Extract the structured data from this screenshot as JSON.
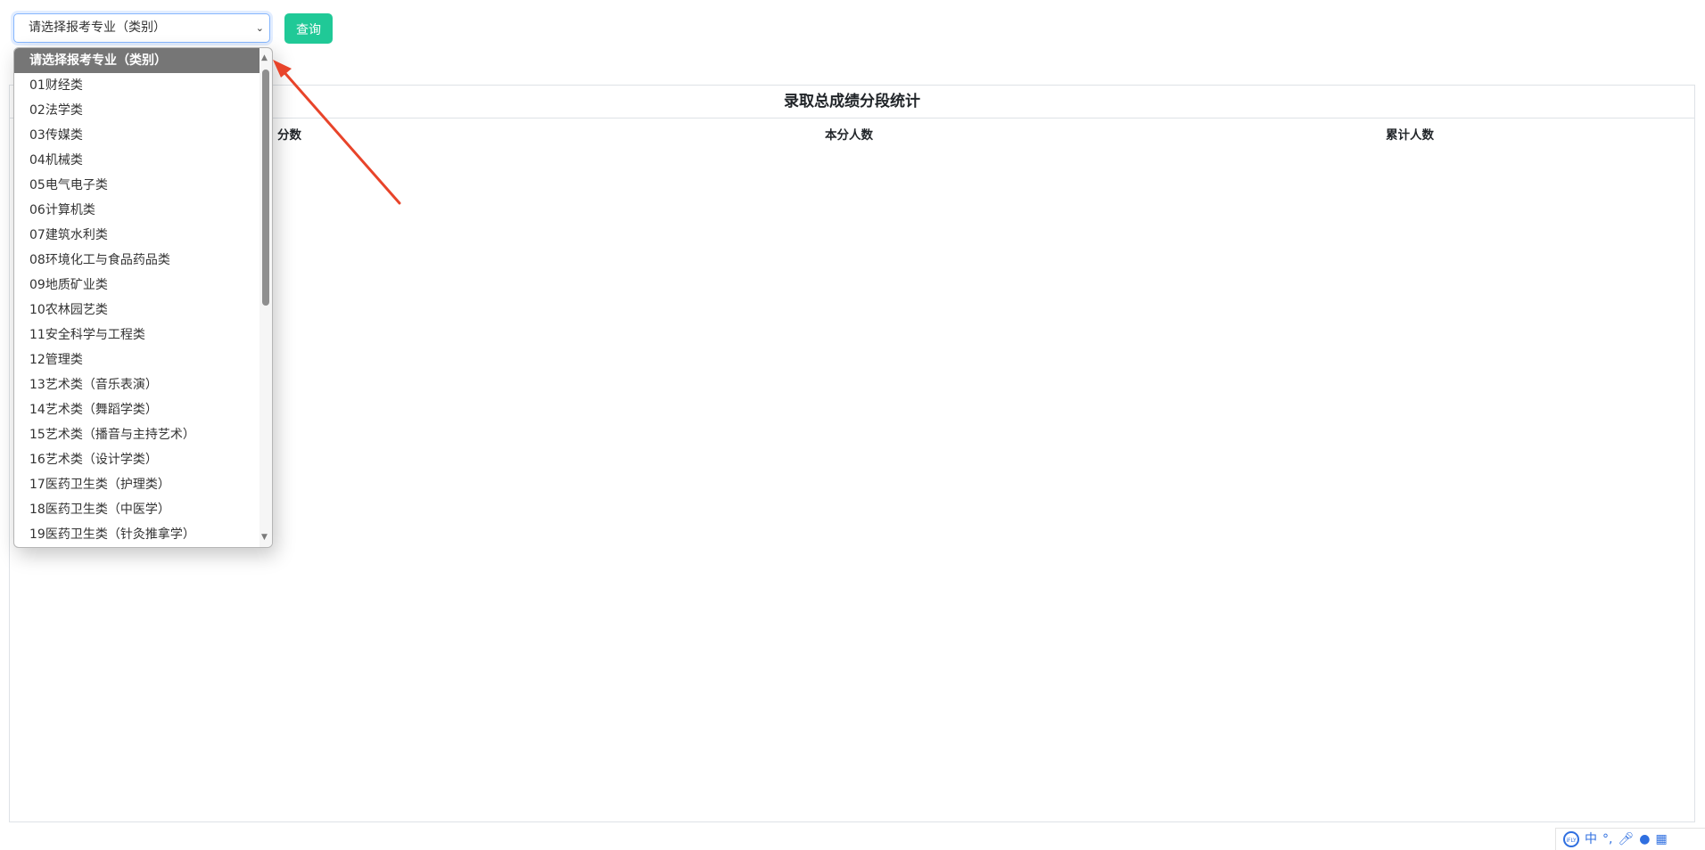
{
  "select": {
    "placeholder": "请选择报考专业（类别）"
  },
  "query_button": {
    "label": "查询"
  },
  "panel": {
    "title": "录取总成绩分段统计",
    "columns": [
      "分数",
      "本分人数",
      "累计人数"
    ]
  },
  "dropdown": {
    "options": [
      "请选择报考专业（类别）",
      "01财经类",
      "02法学类",
      "03传媒类",
      "04机械类",
      "05电气电子类",
      "06计算机类",
      "07建筑水利类",
      "08环境化工与食品药品类",
      "09地质矿业类",
      "10农林园艺类",
      "11安全科学与工程类",
      "12管理类",
      "13艺术类（音乐表演）",
      "14艺术类（舞蹈学类）",
      "15艺术类（播音与主持艺术）",
      "16艺术类（设计学类）",
      "17医药卫生类（护理类）",
      "18医药卫生类（中医学）",
      "19医药卫生类（针灸推拿学）"
    ],
    "selected_index": 0
  },
  "ime_toolbar": {
    "logo_text": "iFLY",
    "lang": "中",
    "punct": "°,"
  },
  "colors": {
    "accent": "#20c997",
    "focus_border": "#86b7fe",
    "selected_option_bg": "#767676",
    "annotation_arrow": "#e8442a",
    "ime_blue": "#2f6fe0"
  }
}
